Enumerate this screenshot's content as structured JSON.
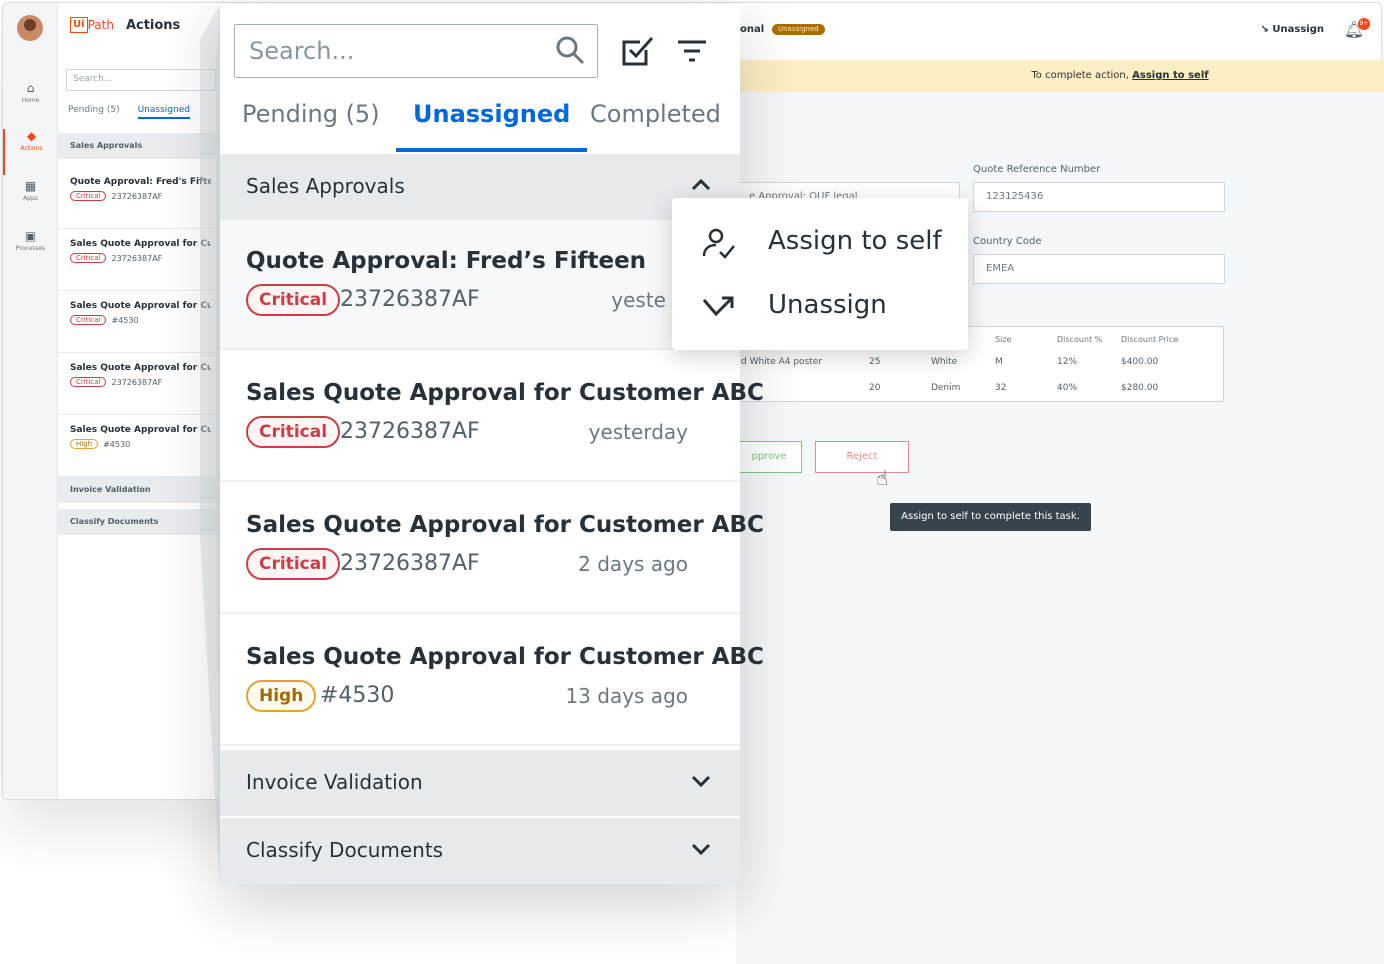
{
  "app": {
    "brand_ui": "Ui",
    "brand_path": "Path",
    "title": "Actions"
  },
  "rail": [
    {
      "label": "Home",
      "icon": "home-icon",
      "glyph": "⌂"
    },
    {
      "label": "Actions",
      "icon": "actions-icon",
      "glyph": "◆"
    },
    {
      "label": "Apps",
      "icon": "apps-icon",
      "glyph": "▦"
    },
    {
      "label": "Processes",
      "icon": "processes-icon",
      "glyph": "▣"
    }
  ],
  "mini": {
    "search_placeholder": "Search...",
    "tab_pending": "Pending (5)",
    "tab_unassigned": "Unassigned",
    "group_sales": "Sales Approvals",
    "cards": [
      {
        "title": "Quote Approval: Fred's Fifteen",
        "tag": "Critical",
        "ref": "23726387AF"
      },
      {
        "title": "Sales Quote Approval for Customer ABC",
        "tag": "Critical",
        "ref": "23726387AF"
      },
      {
        "title": "Sales Quote Approval for Customer ABC",
        "tag": "Critical",
        "ref": "#4530"
      },
      {
        "title": "Sales Quote Approval for Customer ABC",
        "tag": "Critical",
        "ref": "23726387AF"
      },
      {
        "title": "Sales Quote Approval for Customer ABC",
        "tag": "High",
        "ref": "#4530"
      }
    ],
    "group_invoice": "Invoice Validation",
    "group_classify": "Classify Documents"
  },
  "detail": {
    "task_name_fragment": "onal",
    "status_badge": "Unassigned",
    "unassign_label": "Unassign",
    "notification_count": "9+",
    "banner_text": "To complete action,",
    "banner_link": "Assign to self",
    "name_value_fragment": "e Approval: OUF legal",
    "quote_ref_label": "Quote Reference Number",
    "quote_ref_value": "123125436",
    "country_label": "Country Code",
    "country_value": "EMEA",
    "table_headers": [
      "Size",
      "Discount %",
      "Discount Price"
    ],
    "table_rows": [
      {
        "item": "d White A4 poster",
        "qty": "25",
        "color": "White",
        "size": "M",
        "discount": "12%",
        "price": "$400.00"
      },
      {
        "item": "",
        "qty": "20",
        "color": "Denim",
        "size": "32",
        "discount": "40%",
        "price": "$280.00"
      }
    ],
    "approve_label": "pprove",
    "reject_label": "Reject",
    "tooltip": "Assign to self to complete this task."
  },
  "panel": {
    "search_placeholder": "Search...",
    "tabs": [
      "Pending (5)",
      "Unassigned",
      "Completed"
    ],
    "active_tab": "Unassigned",
    "group_sales": "Sales Approvals",
    "cards": [
      {
        "title": "Quote Approval: Fred’s Fifteen",
        "tag": "Critical",
        "ref": "23726387AF",
        "when": "yeste"
      },
      {
        "title": "Sales Quote Approval for Customer ABC",
        "tag": "Critical",
        "ref": "23726387AF",
        "when": "yesterday"
      },
      {
        "title": "Sales Quote Approval for Customer ABC",
        "tag": "Critical",
        "ref": "23726387AF",
        "when": "2 days ago"
      },
      {
        "title": "Sales Quote Approval for Customer ABC",
        "tag": "High",
        "ref": "#4530",
        "when": "13 days ago"
      }
    ],
    "group_invoice": "Invoice Validation",
    "group_classify": "Classify Documents"
  },
  "menu": {
    "assign_label": "Assign to self",
    "unassign_label": "Unassign"
  },
  "colors": {
    "brand": "#fa4616",
    "accent": "#0067df",
    "critical": "#cc3d45",
    "high": "#e5a32c",
    "banner": "#fdefc4"
  }
}
